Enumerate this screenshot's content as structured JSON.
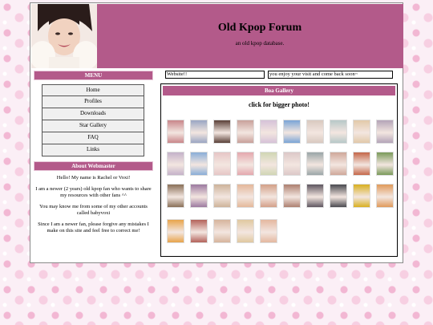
{
  "header": {
    "title": "Old Kpop Forum",
    "subtitle": "an old kpop database."
  },
  "menu": {
    "title": "MENU",
    "items": [
      "Home",
      "Profiles",
      "Downloads",
      "Star Gallery",
      "FAQ",
      "Links"
    ]
  },
  "about": {
    "title": "About Webmaster",
    "paragraphs": [
      "Hello! My name is Rachel or Voxi!",
      "I am a newer (2 years) old kpop fan who wants to share my resources with other fans ^^",
      "You may know me from some of my other accounts called babyvoxi",
      "Since I am a newer fan, please forgive any mistakes I make on this site and feel free to correct me!"
    ]
  },
  "marquee": {
    "left": "Website!!",
    "right": "you enjoy your visit and come back soon~"
  },
  "gallery": {
    "title": "Boa Gallery",
    "caption": "click for bigger photo!",
    "thumb_colors": [
      "#c9868a",
      "#9aa6c3",
      "#5a4038",
      "#c8a09a",
      "#d6c2d8",
      "#7aa4d6",
      "#d9c9c0",
      "#b7c8c8",
      "#e2c9a9",
      "#b4a4b8",
      "#c4b2c9",
      "#8aaed8",
      "#e6c6c6",
      "#e4a8ae",
      "#d0d6b4",
      "#dcc8c8",
      "#9aa6a8",
      "#cfa89a",
      "#c5684a",
      "#7a9a5a",
      "#8a7058",
      "#9c7aa0",
      "#cdb39a",
      "#e4b89a",
      "#d3a088",
      "#ad8070",
      "#5e5660",
      "#4a4a50",
      "#d9b020",
      "#e09a5a",
      "#e8a44a",
      "#b4625a",
      "#d6b49c",
      "#e0c8a0",
      "#e4b8a0"
    ]
  }
}
